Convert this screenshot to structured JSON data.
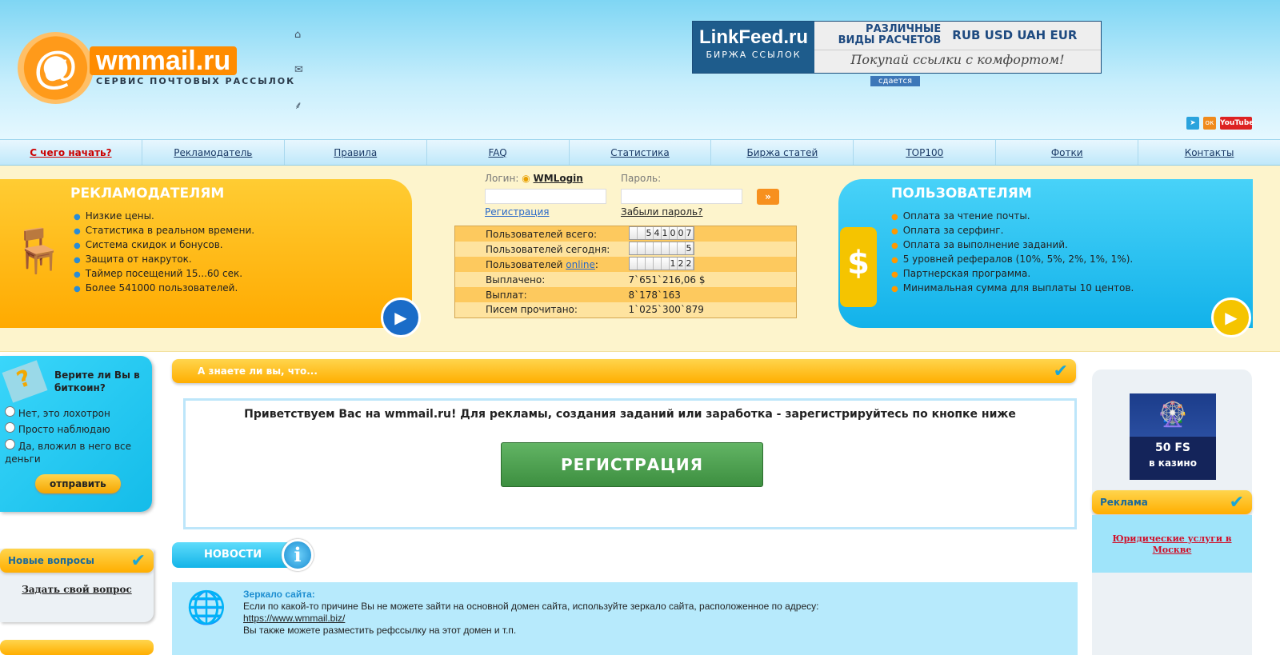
{
  "header": {
    "logo_text": "wmmail.ru",
    "logo_subtitle": "СЕРВИС ПОЧТОВЫХ РАССЫЛОК",
    "icons": [
      "home-icon",
      "mail-icon",
      "sitemap-icon"
    ],
    "banner": {
      "brand": "LinkFeed.ru",
      "brand_sub": "БИРЖА ССЫЛОК",
      "line1a": "РАЗЛИЧНЫЕ",
      "line1b": "ВИДЫ РАСЧЕТОВ",
      "currencies": "RUB USD UAH EUR",
      "slogan": "Покупай ссылки с комфортом!"
    },
    "rent_label": "сдается",
    "social": [
      "telegram-icon",
      "odnoklassniki-icon",
      "youtube-icon"
    ],
    "youtube_label": "YouTube"
  },
  "nav": [
    {
      "label": "С чего начать?"
    },
    {
      "label": "Рекламодатель"
    },
    {
      "label": "Правила"
    },
    {
      "label": "FAQ"
    },
    {
      "label": "Статистика"
    },
    {
      "label": "Биржа статей"
    },
    {
      "label": "TOP100"
    },
    {
      "label": "Фотки"
    },
    {
      "label": "Контакты"
    }
  ],
  "advertisers": {
    "title": "РЕКЛАМОДАТЕЛЯМ",
    "items": [
      "Низкие цены.",
      "Статистика в реальном времени.",
      "Система скидок и бонусов.",
      "Защита от накруток.",
      "Таймер посещений 15...60 сек.",
      "Более 541000 пользователей."
    ]
  },
  "users": {
    "title": "ПОЛЬЗОВАТЕЛЯМ",
    "items": [
      "Оплата за чтение почты.",
      "Оплата за серфинг.",
      "Оплата за выполнение заданий.",
      "5 уровней рефералов (10%, 5%, 2%, 1%, 1%).",
      "Партнерская программа.",
      "Минимальная сумма для выплаты 10 центов."
    ]
  },
  "login": {
    "login_label": "Логин:",
    "wmlogin": "WMLogin",
    "password_label": "Пароль:",
    "login_value": "",
    "password_value": "",
    "register_link": "Регистрация",
    "forgot_link": "Забыли пароль?"
  },
  "stats": {
    "total_label": "Пользователей всего:",
    "total_digits": [
      "",
      "",
      "5",
      "4",
      "1",
      "0",
      "0",
      "7"
    ],
    "today_label": "Пользователей сегодня:",
    "today_digits": [
      "",
      "",
      "",
      "",
      "",
      "",
      "",
      "5"
    ],
    "online_prefix": "Пользователей ",
    "online_link": "online",
    "online_suffix": ":",
    "online_digits": [
      "",
      "",
      "",
      "",
      "",
      "1",
      "2",
      "2"
    ],
    "paid_label": "Выплачено:",
    "paid_value": "7`651`216,06 $",
    "payouts_label": "Выплат:",
    "payouts_value": "8`178`163",
    "read_label": "Писем прочитано:",
    "read_value": "1`025`300`879"
  },
  "poll": {
    "question": "Верите ли Вы в биткоин?",
    "options": [
      "Нет, это лохотрон",
      "Просто наблюдаю",
      "Да, вложил в него все деньги"
    ],
    "submit": "отправить"
  },
  "questions": {
    "title": "Новые вопросы",
    "ask_link": "Задать свой вопрос"
  },
  "did_you_know": "А знаете ли вы, что...",
  "welcome": {
    "text": "Приветствуем Вас на wmmail.ru! Для рекламы, создания заданий или заработка - зарегистрируйтесь по кнопке ниже",
    "register_button": "РЕГИСТРАЦИЯ"
  },
  "news": {
    "tab": "НОВОСТИ",
    "item": {
      "title": "Зеркало сайта:",
      "text": "Если по какой-то причине Вы не можете зайти на основной домен сайта, используйте зеркало сайта, расположенное по адресу:",
      "url": "https://www.wmmail.biz/",
      "note": "Вы также можете разместить рефссылку на этот домен и т.п."
    }
  },
  "ads": {
    "casino_line1": "50 FS",
    "casino_line2": "в казино",
    "title": "Реклама",
    "link": "Юридические услуги в Москве"
  },
  "colors": {
    "accent_orange": "#ffaa00",
    "accent_blue": "#13b4e8",
    "nav_red": "#cc0000",
    "register_green": "#4ca24f"
  }
}
